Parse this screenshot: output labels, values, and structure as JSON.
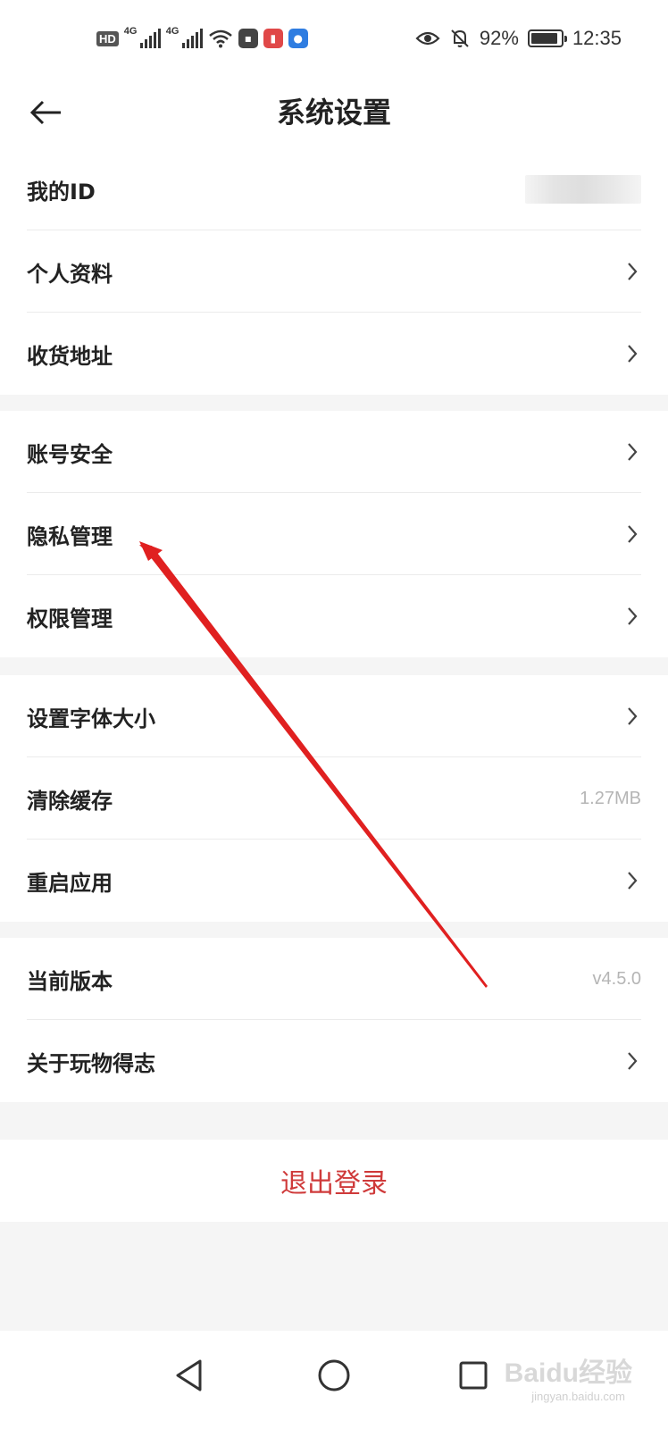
{
  "status_bar": {
    "hd": "HD",
    "net1": "4G",
    "net2": "4G",
    "battery": "92%",
    "battery_level": 0.92,
    "time": "12:35"
  },
  "header": {
    "title": "系统设置"
  },
  "groups": [
    {
      "items": [
        {
          "label": "我的ID"
        },
        {
          "label": "个人资料"
        },
        {
          "label": "收货地址"
        }
      ]
    },
    {
      "items": [
        {
          "label": "账号安全"
        },
        {
          "label": "隐私管理"
        },
        {
          "label": "权限管理"
        }
      ]
    },
    {
      "items": [
        {
          "label": "设置字体大小"
        },
        {
          "label": "清除缓存",
          "value": "1.27MB"
        },
        {
          "label": "重启应用"
        }
      ]
    },
    {
      "items": [
        {
          "label": "当前版本",
          "value": "v4.5.0"
        },
        {
          "label": "关于玩物得志"
        }
      ]
    }
  ],
  "logout": {
    "label": "退出登录"
  },
  "watermark": {
    "text": "Baidu经验",
    "sub": "jingyan.baidu.com"
  },
  "colors": {
    "accent": "#cf3a3a",
    "arrow": "#e02020"
  }
}
